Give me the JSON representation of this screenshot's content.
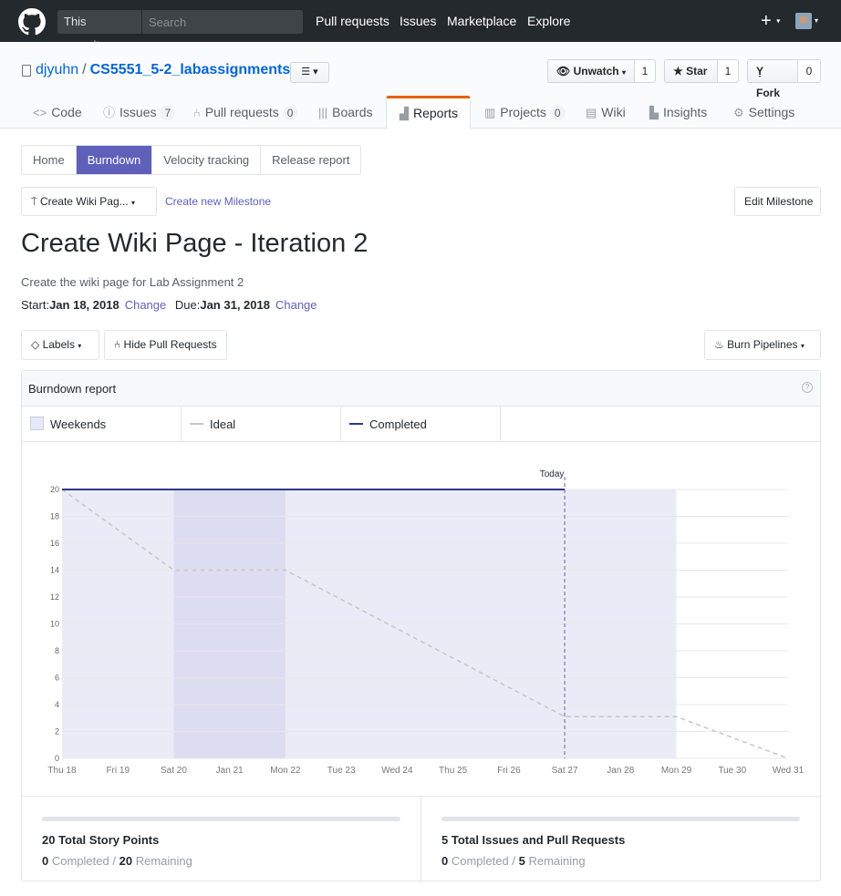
{
  "header": {
    "search_scope": "This repository",
    "search_placeholder": "Search",
    "nav": [
      "Pull requests",
      "Issues",
      "Marketplace",
      "Explore"
    ],
    "plus": "+"
  },
  "repo": {
    "owner": "djyuhn",
    "separator": "/",
    "name": "CS5551_5-2_labassignments",
    "list_menu_icon": "☰ ▾",
    "watch_label": "Unwatch",
    "watch_count": "1",
    "star_label": "Star",
    "star_count": "1",
    "fork_label": "Fork",
    "fork_count": "0"
  },
  "reponav": {
    "code": "Code",
    "issues": "Issues",
    "issues_count": "7",
    "pulls": "Pull requests",
    "pulls_count": "0",
    "boards": "Boards",
    "reports": "Reports",
    "projects": "Projects",
    "projects_count": "0",
    "wiki": "Wiki",
    "insights": "Insights",
    "settings": "Settings"
  },
  "subnav": {
    "home": "Home",
    "burndown": "Burndown",
    "velocity": "Velocity tracking",
    "release": "Release report"
  },
  "milestone": {
    "selector": "Create Wiki Pag...",
    "create_link": "Create new Milestone",
    "edit_button": "Edit Milestone",
    "title": "Create Wiki Page - Iteration 2",
    "description": "Create the wiki page for Lab Assignment 2",
    "start_label": "Start:",
    "start_date": "Jan 18, 2018",
    "change": "Change",
    "due_label": "Due:",
    "due_date": "Jan 31, 2018"
  },
  "filters": {
    "labels": "Labels",
    "hide_prs": "Hide Pull Requests",
    "pipelines": "Burn Pipelines"
  },
  "report": {
    "title": "Burndown report",
    "help": "?",
    "legend": {
      "weekends": "Weekends",
      "ideal": "Ideal",
      "completed": "Completed"
    }
  },
  "chart_data": {
    "type": "line",
    "x": [
      "Thu 18",
      "Fri 19",
      "Sat 20",
      "Jan 21",
      "Mon 22",
      "Tue 23",
      "Wed 24",
      "Thu 25",
      "Fri 26",
      "Sat 27",
      "Jan 28",
      "Mon 29",
      "Tue 30",
      "Wed 31"
    ],
    "y_ticks": [
      0,
      2,
      4,
      6,
      8,
      10,
      12,
      14,
      16,
      18,
      20
    ],
    "ylim": [
      0,
      20
    ],
    "weekends": [
      [
        "Sat 20",
        "Mon 22"
      ]
    ],
    "period_shaded": [
      "Thu 18",
      "Mon 29"
    ],
    "today": {
      "label": "Today",
      "x": "Sat 27"
    },
    "series": [
      {
        "name": "Ideal",
        "color": "#c6c6c6",
        "dashed": true,
        "points": [
          [
            "Thu 18",
            20
          ],
          [
            "Sat 20",
            14
          ],
          [
            "Mon 22",
            14
          ],
          [
            "Sat 27",
            3.1
          ],
          [
            "Mon 29",
            3.1
          ],
          [
            "Wed 31",
            0
          ]
        ]
      },
      {
        "name": "Completed",
        "color": "#2c3a86",
        "dashed": false,
        "points": [
          [
            "Thu 18",
            20
          ],
          [
            "Sat 27",
            20
          ]
        ]
      }
    ],
    "colors": {
      "period": "#ebebf7",
      "weekend": "#dcddf0",
      "today": "#5e60ba",
      "grid": "#e8e8e8"
    }
  },
  "stats": {
    "left": {
      "title": "20 Total Story Points",
      "completed_num": "0",
      "completed_label": "Completed",
      "slash": "/",
      "remaining_num": "20",
      "remaining_label": "Remaining"
    },
    "right": {
      "title": "5 Total Issues and Pull Requests",
      "completed_num": "0",
      "completed_label": "Completed",
      "slash": "/",
      "remaining_num": "5",
      "remaining_label": "Remaining"
    }
  }
}
